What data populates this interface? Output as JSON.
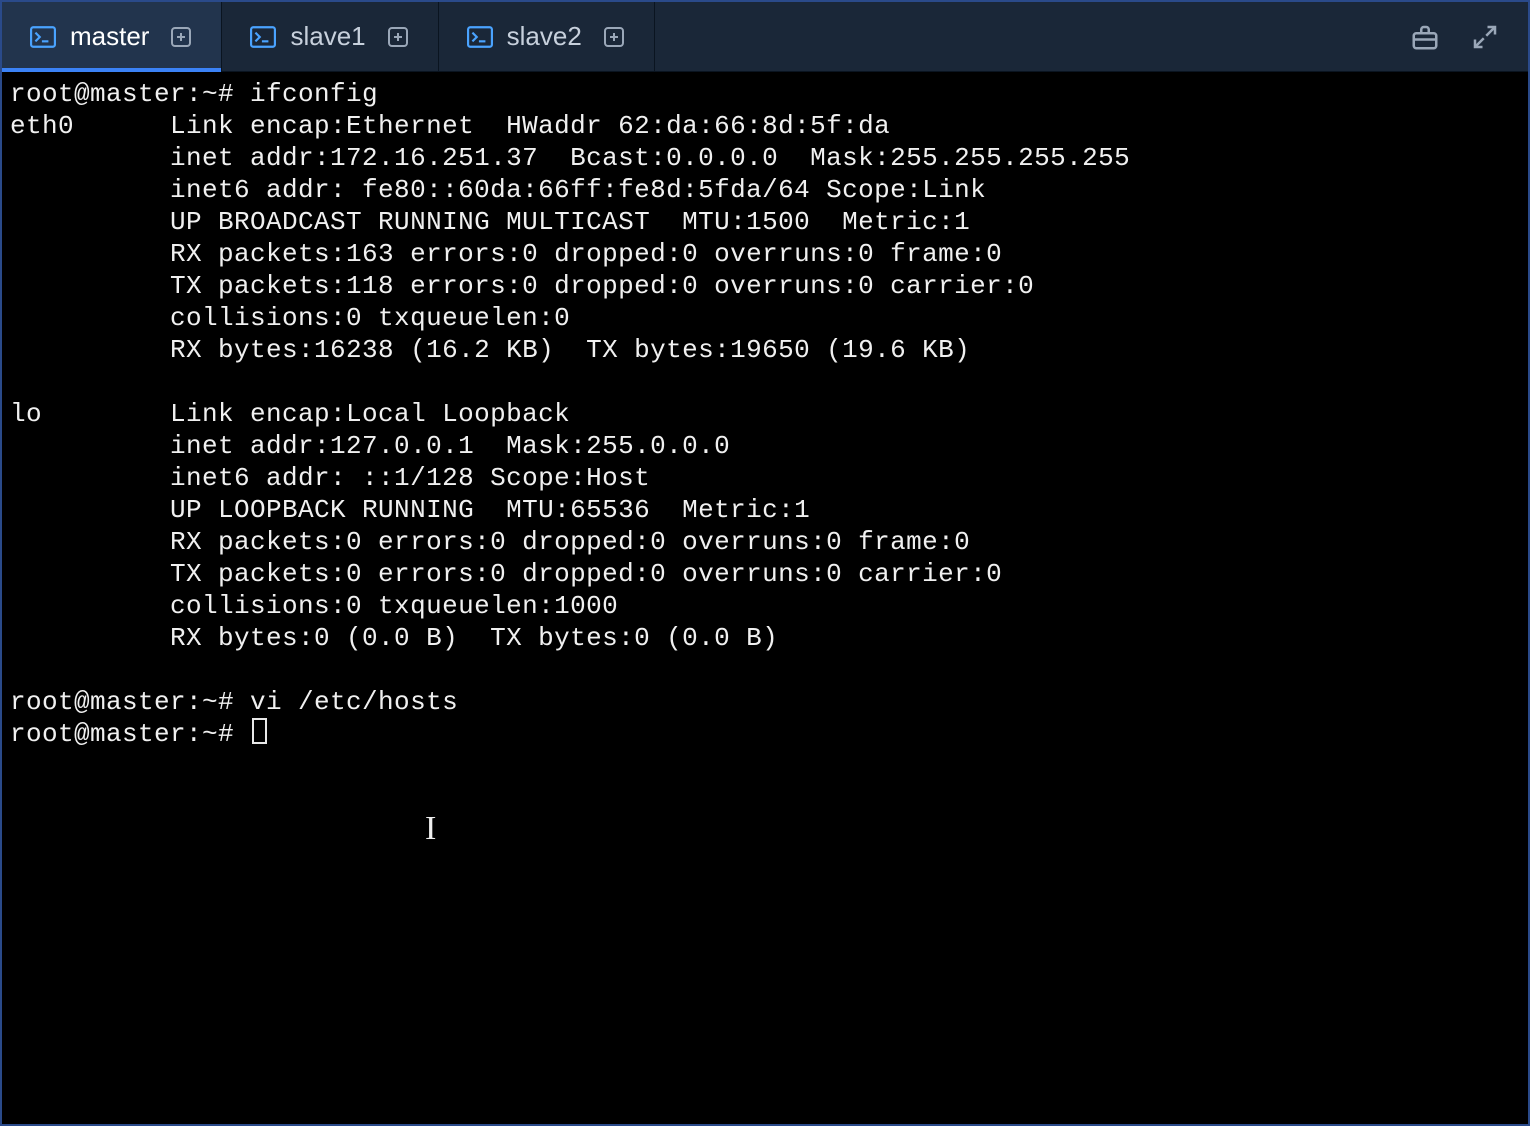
{
  "colors": {
    "accent": "#3b82f6",
    "tabbar_bg": "#1a2738",
    "tab_active_bg": "#22344d",
    "terminal_bg": "#000000",
    "terminal_fg": "#f0f0f0"
  },
  "tabs": [
    {
      "label": "master",
      "active": true
    },
    {
      "label": "slave1",
      "active": false
    },
    {
      "label": "slave2",
      "active": false
    }
  ],
  "terminal": {
    "prompt": "root@master:~# ",
    "commands": [
      {
        "cmd": "ifconfig"
      },
      {
        "cmd": "vi /etc/hosts"
      },
      {
        "cmd": ""
      }
    ],
    "ifconfig": {
      "interfaces": [
        {
          "name": "eth0",
          "lines": [
            "Link encap:Ethernet  HWaddr 62:da:66:8d:5f:da",
            "inet addr:172.16.251.37  Bcast:0.0.0.0  Mask:255.255.255.255",
            "inet6 addr: fe80::60da:66ff:fe8d:5fda/64 Scope:Link",
            "UP BROADCAST RUNNING MULTICAST  MTU:1500  Metric:1",
            "RX packets:163 errors:0 dropped:0 overruns:0 frame:0",
            "TX packets:118 errors:0 dropped:0 overruns:0 carrier:0",
            "collisions:0 txqueuelen:0",
            "RX bytes:16238 (16.2 KB)  TX bytes:19650 (19.6 KB)"
          ]
        },
        {
          "name": "lo",
          "lines": [
            "Link encap:Local Loopback",
            "inet addr:127.0.0.1  Mask:255.0.0.0",
            "inet6 addr: ::1/128 Scope:Host",
            "UP LOOPBACK RUNNING  MTU:65536  Metric:1",
            "RX packets:0 errors:0 dropped:0 overruns:0 frame:0",
            "TX packets:0 errors:0 dropped:0 overruns:0 carrier:0",
            "collisions:0 txqueuelen:1000",
            "RX bytes:0 (0.0 B)  TX bytes:0 (0.0 B)"
          ]
        }
      ]
    }
  }
}
